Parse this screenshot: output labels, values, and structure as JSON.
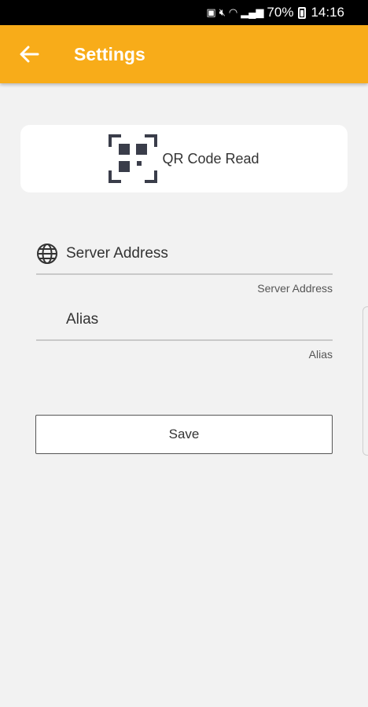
{
  "status_bar": {
    "battery": "70%",
    "time": "14:16"
  },
  "app_bar": {
    "title": "Settings",
    "back_icon": "arrow-left-icon"
  },
  "qr": {
    "label": "QR Code Read",
    "icon": "qr-scan-icon"
  },
  "server_field": {
    "placeholder": "Server Address",
    "value": "",
    "hint": "Server Address",
    "icon": "globe-icon"
  },
  "alias_field": {
    "placeholder": "Alias",
    "value": "",
    "hint": "Alias"
  },
  "save_label": "Save",
  "colors": {
    "app_bar": "#f8ac19",
    "background": "#f2f2f2",
    "qr_icon": "#3a3d4a"
  }
}
